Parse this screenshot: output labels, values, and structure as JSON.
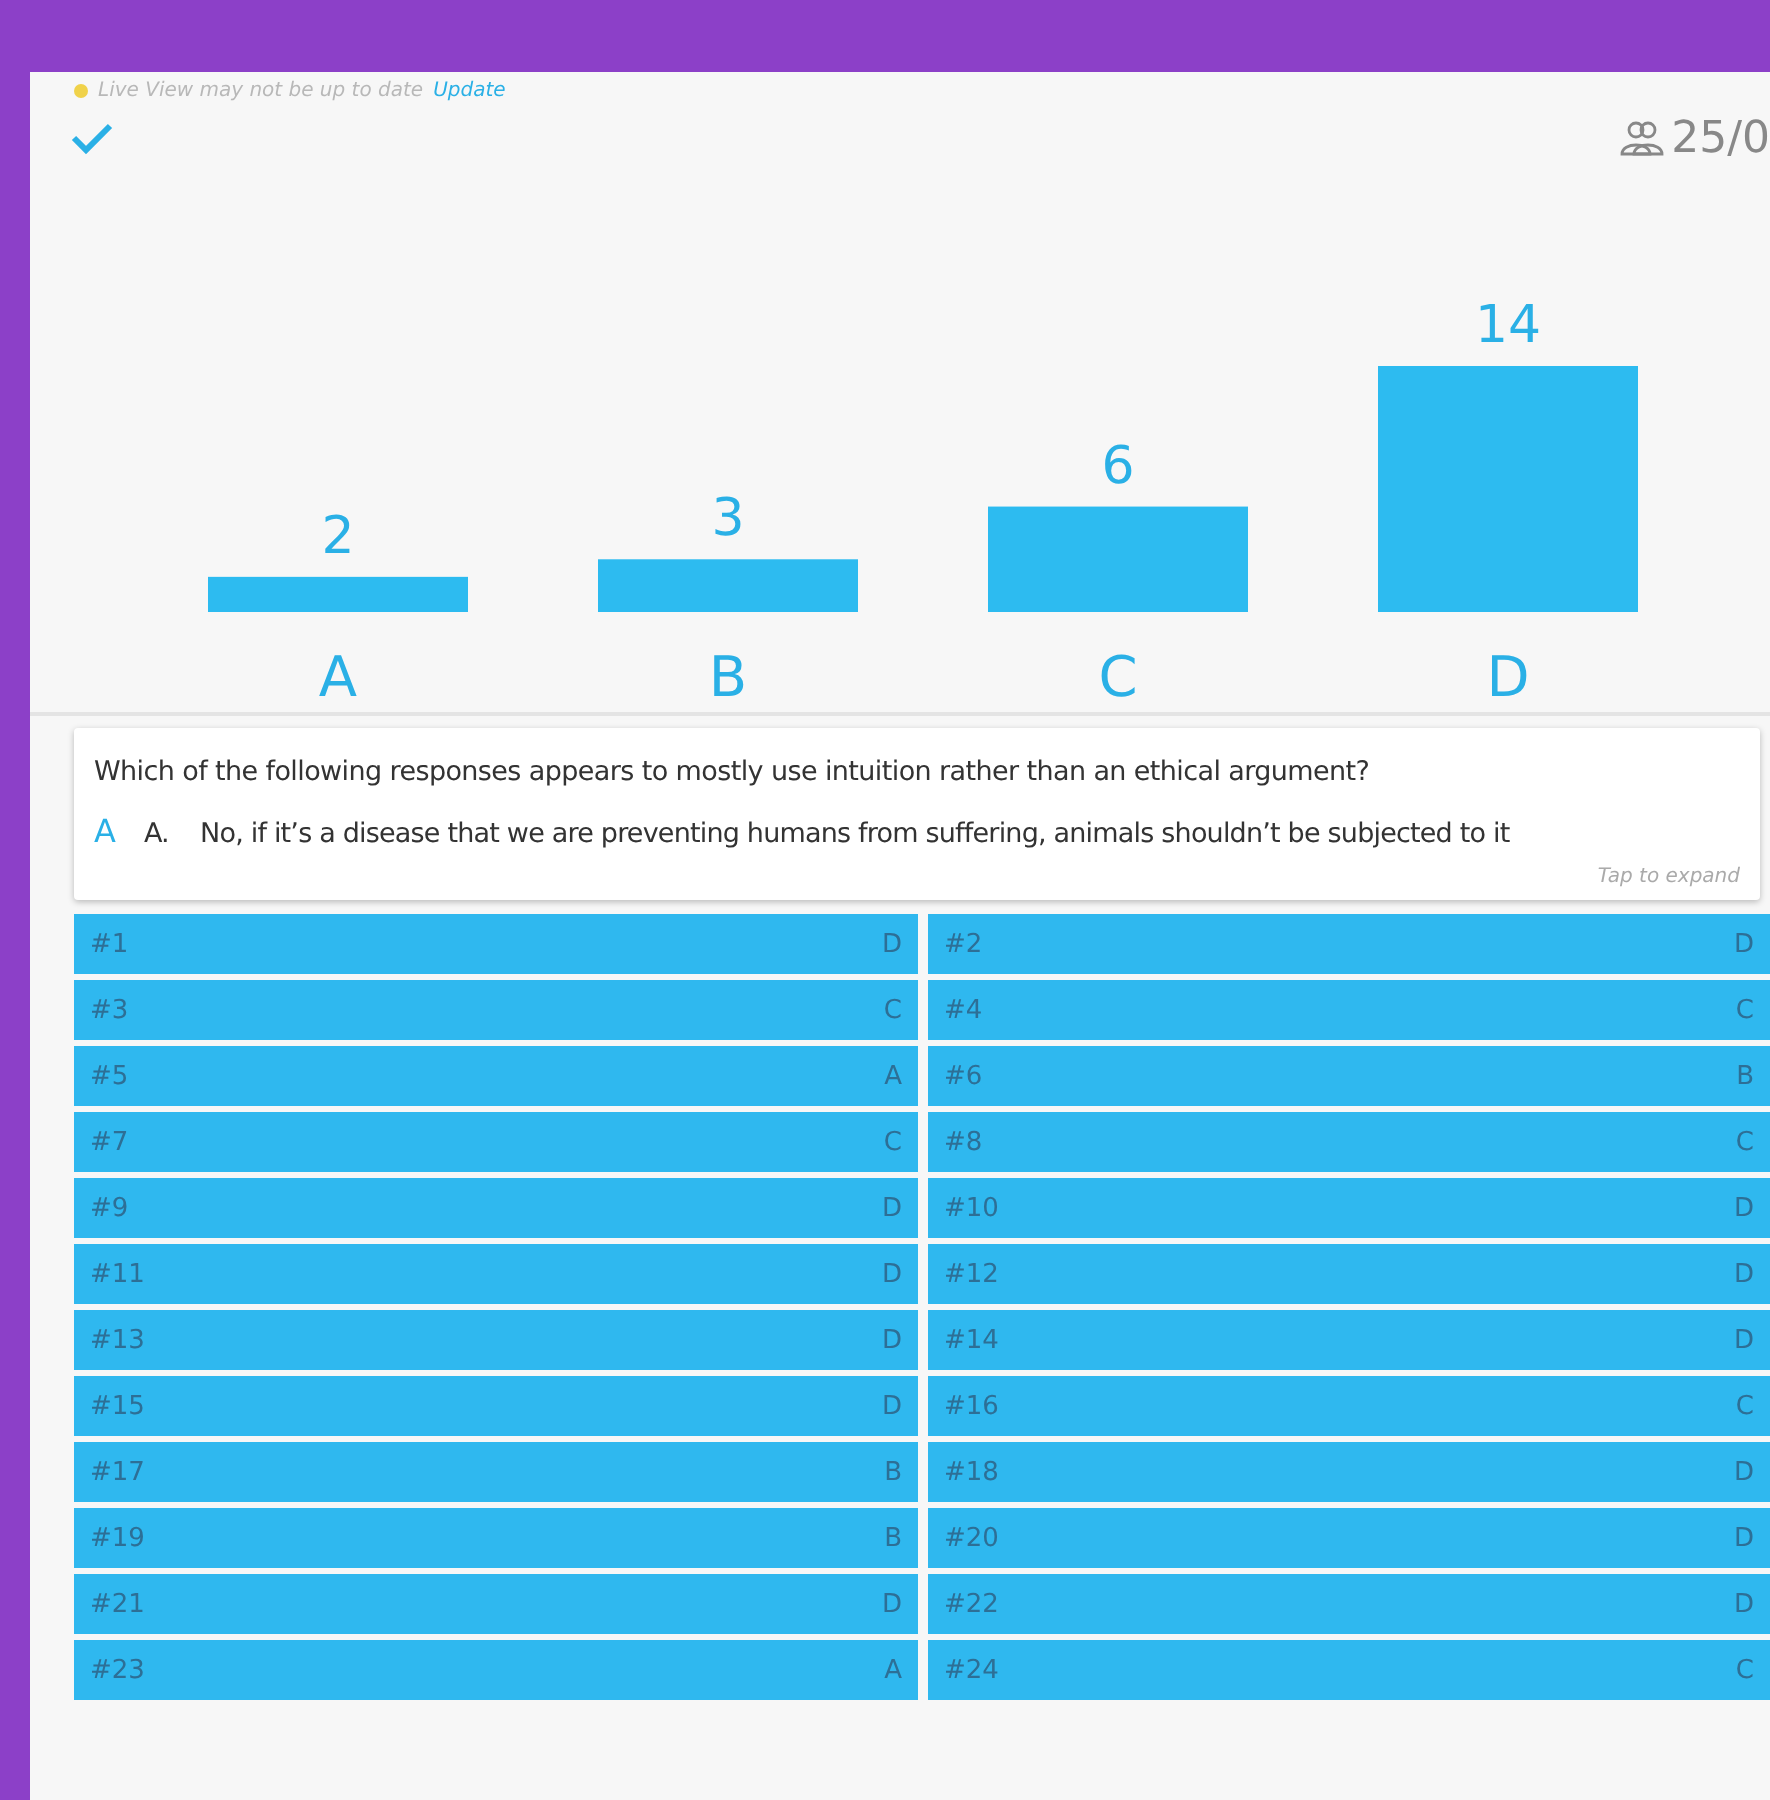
{
  "status": {
    "message": "Live View may not be up to date",
    "link": "Update"
  },
  "header": {
    "count": "25/0"
  },
  "chart": {
    "chart_data": {
      "type": "bar",
      "categories": [
        "A",
        "B",
        "C",
        "D"
      ],
      "values": [
        2,
        3,
        6,
        14
      ],
      "data_labels": true
    }
  },
  "question": {
    "text": "Which of the following responses appears to mostly use intuition rather than an ethical argument?",
    "answer_letter": "A",
    "answer_text": "A.    No, if it’s a disease that we are preventing humans from suffering, animals shouldn’t be subjected to it",
    "hint": "Tap to expand"
  },
  "responses": [
    {
      "label": "#1",
      "answer": "D"
    },
    {
      "label": "#2",
      "answer": "D"
    },
    {
      "label": "#3",
      "answer": "C"
    },
    {
      "label": "#4",
      "answer": "C"
    },
    {
      "label": "#5",
      "answer": "A"
    },
    {
      "label": "#6",
      "answer": "B"
    },
    {
      "label": "#7",
      "answer": "C"
    },
    {
      "label": "#8",
      "answer": "C"
    },
    {
      "label": "#9",
      "answer": "D"
    },
    {
      "label": "#10",
      "answer": "D"
    },
    {
      "label": "#11",
      "answer": "D"
    },
    {
      "label": "#12",
      "answer": "D"
    },
    {
      "label": "#13",
      "answer": "D"
    },
    {
      "label": "#14",
      "answer": "D"
    },
    {
      "label": "#15",
      "answer": "D"
    },
    {
      "label": "#16",
      "answer": "C"
    },
    {
      "label": "#17",
      "answer": "B"
    },
    {
      "label": "#18",
      "answer": "D"
    },
    {
      "label": "#19",
      "answer": "B"
    },
    {
      "label": "#20",
      "answer": "D"
    },
    {
      "label": "#21",
      "answer": "D"
    },
    {
      "label": "#22",
      "answer": "D"
    },
    {
      "label": "#23",
      "answer": "A"
    },
    {
      "label": "#24",
      "answer": "C"
    }
  ]
}
